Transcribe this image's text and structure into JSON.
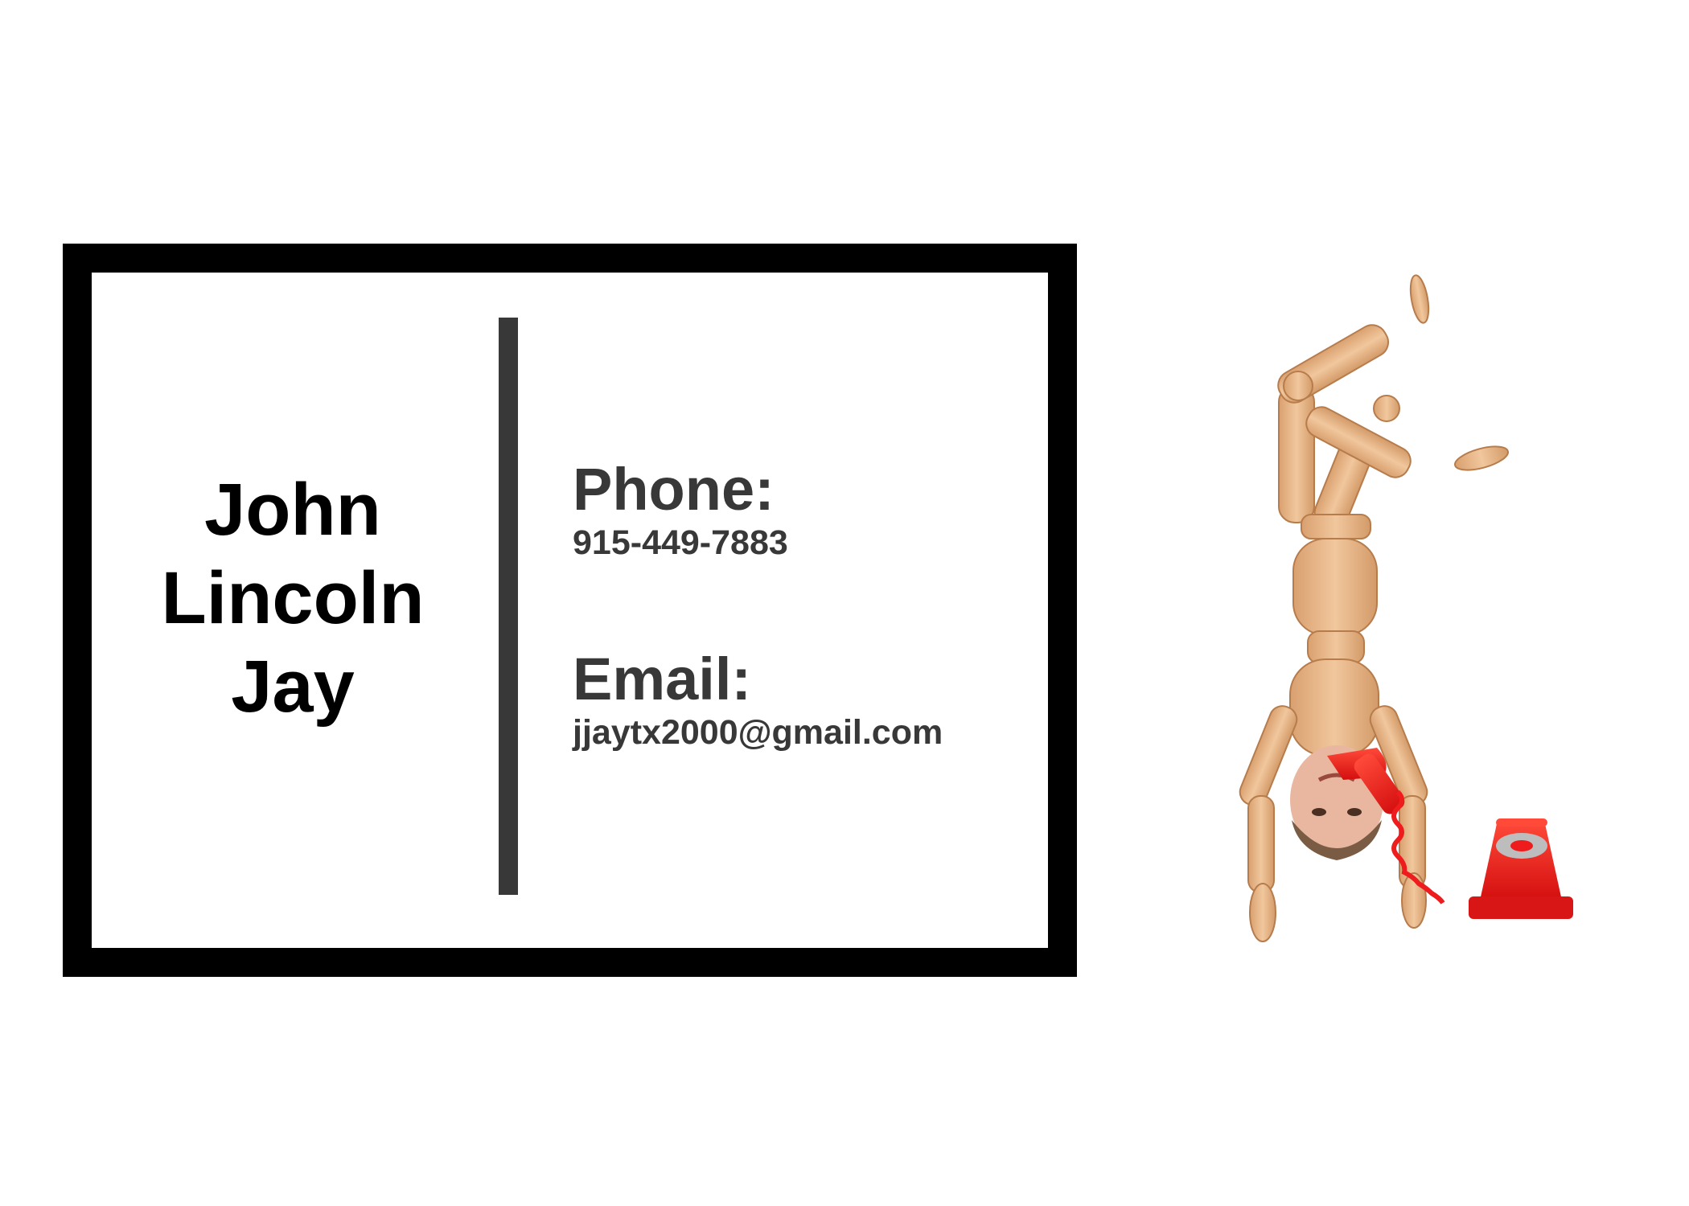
{
  "card": {
    "name_lines": [
      "John",
      "Lincoln",
      "Jay"
    ],
    "phone_label": "Phone:",
    "phone_value": "915-449-7883",
    "email_label": "Email:",
    "email_value": "jjaytx2000@gmail.com"
  },
  "colors": {
    "border": "#000000",
    "text_dark": "#383838",
    "divider": "#383838",
    "wood": "#e8b98c",
    "telephone_red": "#ee1c1c"
  },
  "illustration": {
    "icon": "upside-down-mannequin-with-telephone-icon"
  }
}
